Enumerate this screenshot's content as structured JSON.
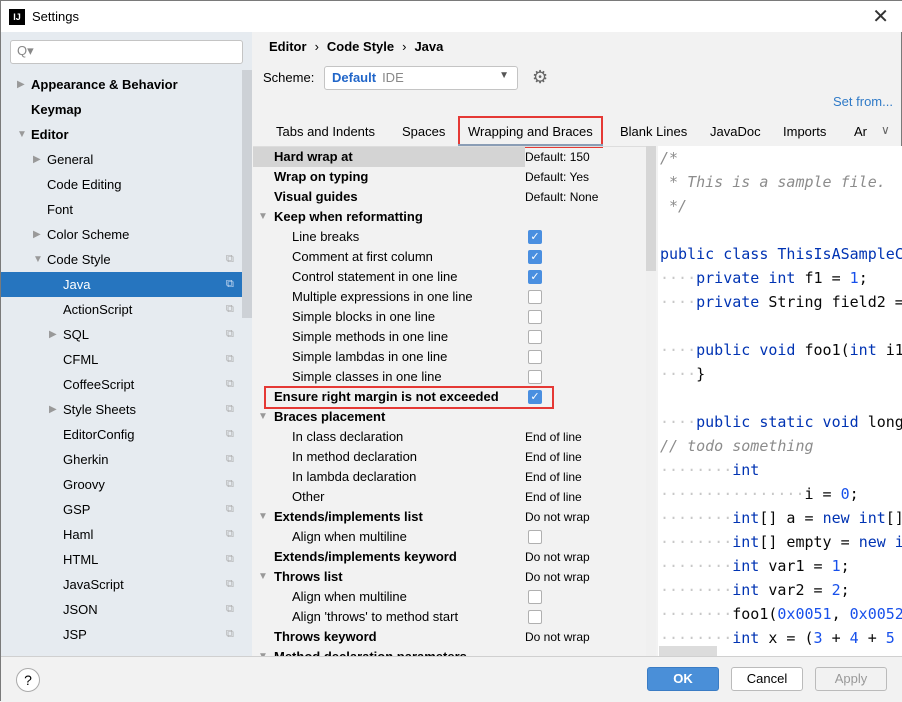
{
  "window": {
    "title": "Settings",
    "app_icon": "IJ",
    "close": "✕"
  },
  "sidebar": {
    "search_placeholder": "Q▾",
    "items": [
      {
        "label": "Appearance & Behavior",
        "level": 0,
        "bold": true,
        "arrow": "▶"
      },
      {
        "label": "Keymap",
        "level": 0,
        "bold": true,
        "arrow": ""
      },
      {
        "label": "Editor",
        "level": 0,
        "bold": true,
        "arrow": "▼"
      },
      {
        "label": "General",
        "level": 1,
        "arrow": "▶"
      },
      {
        "label": "Code Editing",
        "level": 1,
        "arrow": ""
      },
      {
        "label": "Font",
        "level": 1,
        "arrow": ""
      },
      {
        "label": "Color Scheme",
        "level": 1,
        "arrow": "▶"
      },
      {
        "label": "Code Style",
        "level": 1,
        "arrow": "▼",
        "copy": true
      },
      {
        "label": "Java",
        "level": 2,
        "arrow": "",
        "copy": true,
        "selected": true
      },
      {
        "label": "ActionScript",
        "level": 2,
        "arrow": "",
        "copy": true
      },
      {
        "label": "SQL",
        "level": 2,
        "arrow": "▶",
        "copy": true
      },
      {
        "label": "CFML",
        "level": 2,
        "arrow": "",
        "copy": true
      },
      {
        "label": "CoffeeScript",
        "level": 2,
        "arrow": "",
        "copy": true
      },
      {
        "label": "Style Sheets",
        "level": 2,
        "arrow": "▶",
        "copy": true
      },
      {
        "label": "EditorConfig",
        "level": 2,
        "arrow": "",
        "copy": true
      },
      {
        "label": "Gherkin",
        "level": 2,
        "arrow": "",
        "copy": true
      },
      {
        "label": "Groovy",
        "level": 2,
        "arrow": "",
        "copy": true
      },
      {
        "label": "GSP",
        "level": 2,
        "arrow": "",
        "copy": true
      },
      {
        "label": "Haml",
        "level": 2,
        "arrow": "",
        "copy": true
      },
      {
        "label": "HTML",
        "level": 2,
        "arrow": "",
        "copy": true
      },
      {
        "label": "JavaScript",
        "level": 2,
        "arrow": "",
        "copy": true
      },
      {
        "label": "JSON",
        "level": 2,
        "arrow": "",
        "copy": true
      },
      {
        "label": "JSP",
        "level": 2,
        "arrow": "",
        "copy": true
      }
    ]
  },
  "breadcrumb": [
    "Editor",
    "Code Style",
    "Java"
  ],
  "breadcrumb_sep": "›",
  "scheme": {
    "label": "Scheme:",
    "value": "Default",
    "kind": "IDE"
  },
  "set_from": "Set from...",
  "tabs": [
    {
      "label": "Tabs and Indents"
    },
    {
      "label": "Spaces"
    },
    {
      "label": "Wrapping and Braces",
      "active": true
    },
    {
      "label": "Blank Lines"
    },
    {
      "label": "JavaDoc"
    },
    {
      "label": "Imports"
    },
    {
      "label": "Ar"
    }
  ],
  "options": [
    {
      "label": "Hard wrap at",
      "bold": true,
      "value": "Default: 150",
      "highlight": true
    },
    {
      "label": "Wrap on typing",
      "bold": true,
      "value": "Default: Yes"
    },
    {
      "label": "Visual guides",
      "bold": true,
      "value": "Default: None"
    },
    {
      "label": "Keep when reformatting",
      "bold": true,
      "group": true
    },
    {
      "label": "Line breaks",
      "indent": true,
      "checked": true
    },
    {
      "label": "Comment at first column",
      "indent": true,
      "checked": true
    },
    {
      "label": "Control statement in one line",
      "indent": true,
      "checked": true
    },
    {
      "label": "Multiple expressions in one line",
      "indent": true,
      "checked": false
    },
    {
      "label": "Simple blocks in one line",
      "indent": true,
      "checked": false
    },
    {
      "label": "Simple methods in one line",
      "indent": true,
      "checked": false
    },
    {
      "label": "Simple lambdas in one line",
      "indent": true,
      "checked": false
    },
    {
      "label": "Simple classes in one line",
      "indent": true,
      "checked": false
    },
    {
      "label": "Ensure right margin is not exceeded",
      "bold": true,
      "checked": true
    },
    {
      "label": "Braces placement",
      "bold": true,
      "group": true
    },
    {
      "label": "In class declaration",
      "indent": true,
      "value": "End of line"
    },
    {
      "label": "In method declaration",
      "indent": true,
      "value": "End of line"
    },
    {
      "label": "In lambda declaration",
      "indent": true,
      "value": "End of line"
    },
    {
      "label": "Other",
      "indent": true,
      "value": "End of line"
    },
    {
      "label": "Extends/implements list",
      "bold": true,
      "group": true,
      "value": "Do not wrap"
    },
    {
      "label": "Align when multiline",
      "indent": true,
      "checked": false
    },
    {
      "label": "Extends/implements keyword",
      "bold": true,
      "value": "Do not wrap"
    },
    {
      "label": "Throws list",
      "bold": true,
      "group": true,
      "value": "Do not wrap"
    },
    {
      "label": "Align when multiline",
      "indent": true,
      "checked": false
    },
    {
      "label": "Align 'throws' to method start",
      "indent": true,
      "checked": false
    },
    {
      "label": "Throws keyword",
      "bold": true,
      "value": "Do not wrap"
    },
    {
      "label": "Method declaration parameters",
      "bold": true,
      "group": true
    }
  ],
  "code_lines": [
    [
      [
        "/*",
        "c"
      ]
    ],
    [
      [
        " * This is a sample file.",
        "c"
      ]
    ],
    [
      [
        " */",
        "c"
      ]
    ],
    [],
    [
      [
        "public class ThisIsASampleC",
        "k"
      ]
    ],
    [
      [
        "····",
        "d"
      ],
      [
        "private int ",
        "k"
      ],
      [
        "f1 = ",
        "p"
      ],
      [
        "1",
        "n"
      ],
      [
        ";",
        "p"
      ]
    ],
    [
      [
        "····",
        "d"
      ],
      [
        "private ",
        "k"
      ],
      [
        "String field2 =",
        "p"
      ]
    ],
    [],
    [
      [
        "····",
        "d"
      ],
      [
        "public void ",
        "k"
      ],
      [
        "foo1(",
        "p"
      ],
      [
        "int ",
        "k"
      ],
      [
        "i1",
        "p"
      ]
    ],
    [
      [
        "····",
        "d"
      ],
      [
        "}",
        "p"
      ]
    ],
    [],
    [
      [
        "····",
        "d"
      ],
      [
        "public static void ",
        "k"
      ],
      [
        "long",
        "p"
      ]
    ],
    [
      [
        "// todo something",
        "c"
      ]
    ],
    [
      [
        "········",
        "d"
      ],
      [
        "int",
        "k"
      ]
    ],
    [
      [
        "················",
        "d"
      ],
      [
        "i = ",
        "p"
      ],
      [
        "0",
        "n"
      ],
      [
        ";",
        "p"
      ]
    ],
    [
      [
        "········",
        "d"
      ],
      [
        "int",
        "k"
      ],
      [
        "[] a = ",
        "p"
      ],
      [
        "new int",
        "k"
      ],
      [
        "[]",
        "p"
      ]
    ],
    [
      [
        "········",
        "d"
      ],
      [
        "int",
        "k"
      ],
      [
        "[] empty = ",
        "p"
      ],
      [
        "new i",
        "k"
      ]
    ],
    [
      [
        "········",
        "d"
      ],
      [
        "int ",
        "k"
      ],
      [
        "var1 = ",
        "p"
      ],
      [
        "1",
        "n"
      ],
      [
        ";",
        "p"
      ]
    ],
    [
      [
        "········",
        "d"
      ],
      [
        "int ",
        "k"
      ],
      [
        "var2 = ",
        "p"
      ],
      [
        "2",
        "n"
      ],
      [
        ";",
        "p"
      ]
    ],
    [
      [
        "········",
        "d"
      ],
      [
        "foo1(",
        "p"
      ],
      [
        "0x0051",
        "n"
      ],
      [
        ", ",
        "p"
      ],
      [
        "0x0052",
        "n"
      ]
    ],
    [
      [
        "········",
        "d"
      ],
      [
        "int ",
        "k"
      ],
      [
        "x = (",
        "p"
      ],
      [
        "3",
        "n"
      ],
      [
        " + ",
        "p"
      ],
      [
        "4",
        "n"
      ],
      [
        " + ",
        "p"
      ],
      [
        "5",
        "n"
      ]
    ]
  ],
  "footer": {
    "help": "?",
    "ok": "OK",
    "cancel": "Cancel",
    "apply": "Apply"
  },
  "colors": {
    "accent": "#2675bf",
    "highlight_border": "#e53935",
    "ok_button": "#4a8fd8"
  }
}
